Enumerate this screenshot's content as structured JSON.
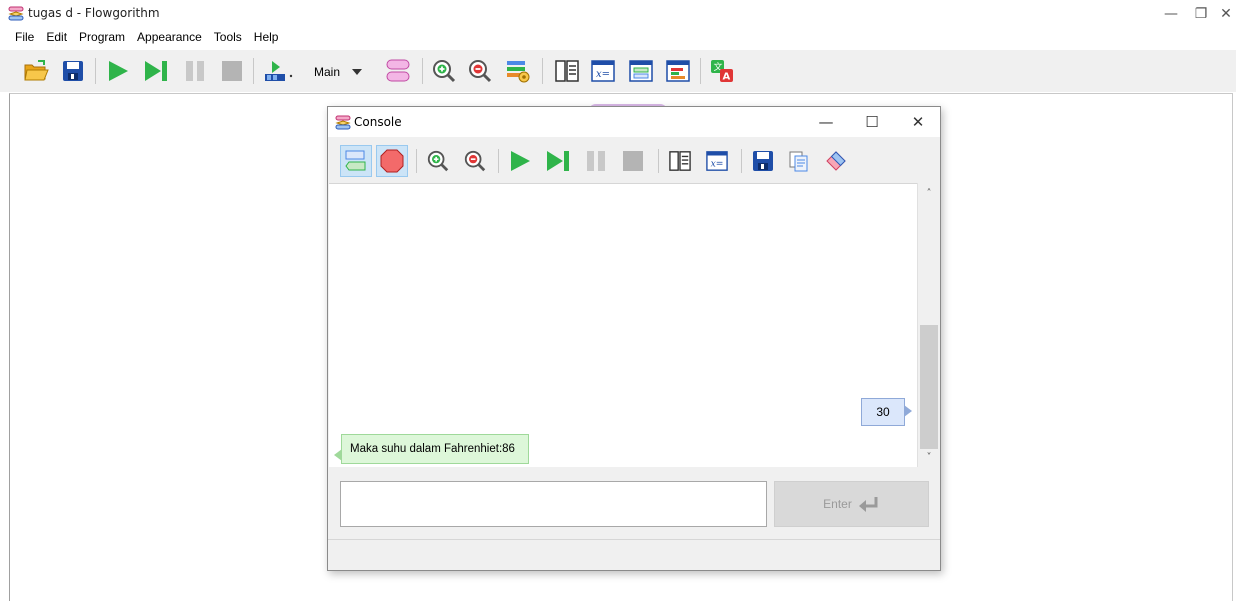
{
  "window": {
    "title": "tugas d - Flowgorithm",
    "minimize_glyph": "—",
    "maximize_glyph": "❐",
    "close_glyph": "✕"
  },
  "menu": {
    "items": [
      {
        "label": "File"
      },
      {
        "label": "Edit"
      },
      {
        "label": "Program"
      },
      {
        "label": "Appearance"
      },
      {
        "label": "Tools"
      },
      {
        "label": "Help"
      }
    ]
  },
  "toolbar": {
    "function_selector": {
      "value": "Main"
    },
    "icons": [
      "open-folder-icon",
      "save-icon",
      "run-icon",
      "step-icon",
      "pause-icon",
      "stop-icon",
      "add-function-icon",
      "function-shape-icon",
      "zoom-in-icon",
      "zoom-out-icon",
      "layout-icon",
      "variable-watch-icon",
      "variables-icon",
      "console-icon",
      "chart-icon",
      "translate-icon"
    ]
  },
  "console": {
    "title": "Console",
    "minimize_glyph": "—",
    "maximize_glyph": "☐",
    "close_glyph": "✕",
    "messages": {
      "input_value": "30",
      "output_text": "Maka suhu dalam Fahrenhiet:86"
    },
    "input": {
      "value": "",
      "placeholder": ""
    },
    "enter_label": "Enter",
    "scroll_up": "˄",
    "scroll_down": "˅"
  },
  "colors": {
    "run_green": "#2fb44a",
    "save_blue": "#1f4ea8",
    "output_bubble": "#ddf7d9",
    "input_bubble": "#dbe7fb",
    "active_button": "#cce4f7"
  }
}
